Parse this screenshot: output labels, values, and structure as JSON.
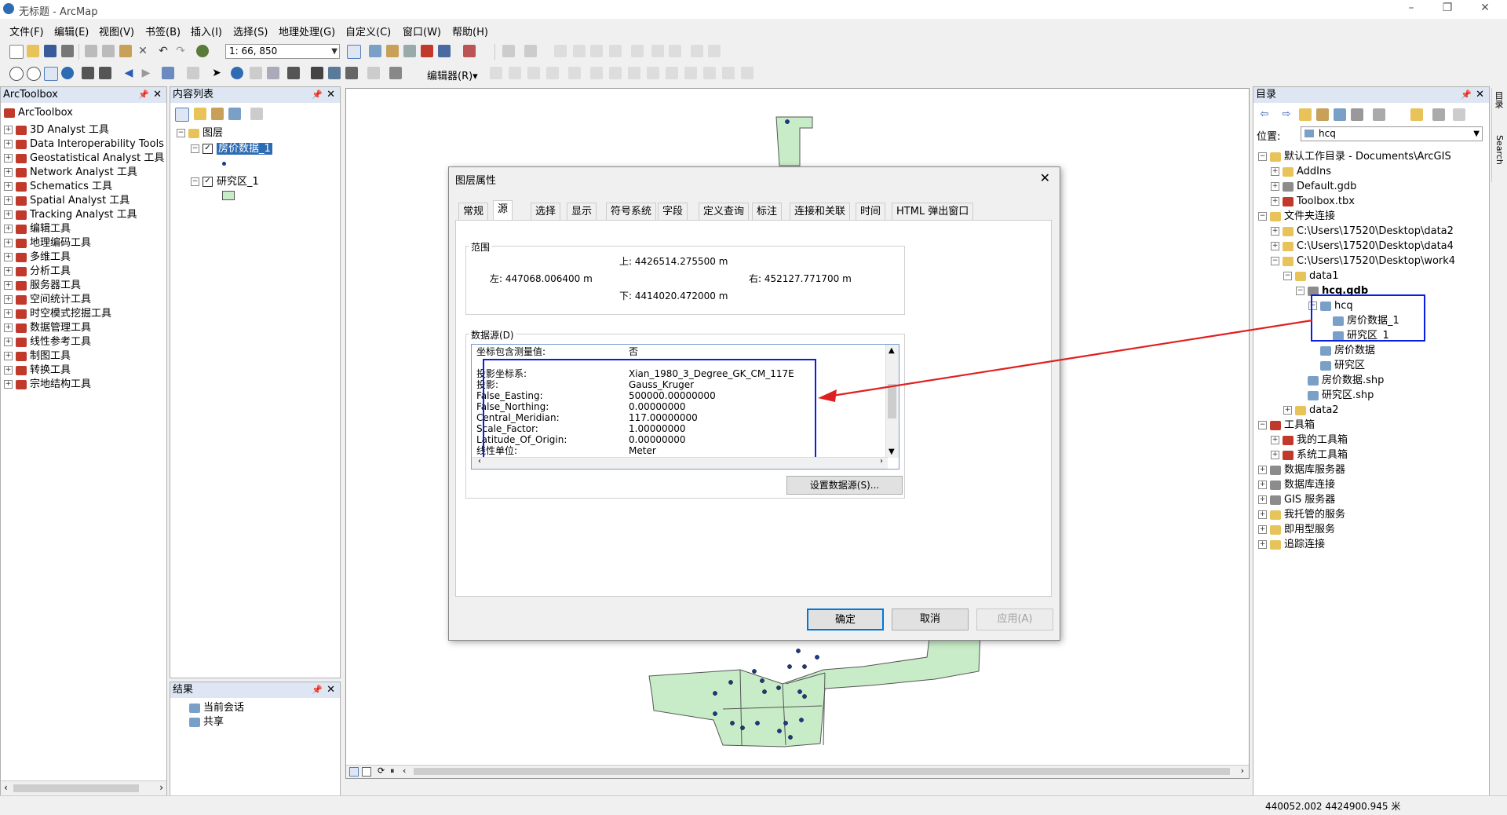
{
  "window": {
    "title": "无标题 - ArcMap"
  },
  "menu": [
    "文件(F)",
    "编辑(E)",
    "视图(V)",
    "书签(B)",
    "插入(I)",
    "选择(S)",
    "地理处理(G)",
    "自定义(C)",
    "窗口(W)",
    "帮助(H)"
  ],
  "toolbar": {
    "scale": "1: 66, 850",
    "editor": "编辑器(R)▾"
  },
  "arctoolbox": {
    "header": "ArcToolbox",
    "root": "ArcToolbox",
    "items": [
      "3D Analyst 工具",
      "Data Interoperability Tools",
      "Geostatistical Analyst 工具",
      "Network Analyst 工具",
      "Schematics 工具",
      "Spatial Analyst 工具",
      "Tracking Analyst 工具",
      "编辑工具",
      "地理编码工具",
      "多维工具",
      "分析工具",
      "服务器工具",
      "空间统计工具",
      "时空模式挖掘工具",
      "数据管理工具",
      "线性参考工具",
      "制图工具",
      "转换工具",
      "宗地结构工具"
    ]
  },
  "toc": {
    "header": "内容列表",
    "root": "图层",
    "layer1": "房价数据_1",
    "layer2": "研究区_1"
  },
  "results": {
    "header": "结果",
    "items": [
      "当前会话",
      "共享"
    ]
  },
  "catalog": {
    "header": "目录",
    "location_label": "位置:",
    "location_value": "hcq",
    "tree": [
      {
        "label": "默认工作目录 - Documents\\ArcGIS",
        "level": 0,
        "icon": "folder",
        "exp": "-"
      },
      {
        "label": "AddIns",
        "level": 1,
        "icon": "folder",
        "exp": "+"
      },
      {
        "label": "Default.gdb",
        "level": 1,
        "icon": "db",
        "exp": "+"
      },
      {
        "label": "Toolbox.tbx",
        "level": 1,
        "icon": "tbox",
        "exp": "+"
      },
      {
        "label": "文件夹连接",
        "level": 0,
        "icon": "folder",
        "exp": "-"
      },
      {
        "label": "C:\\Users\\17520\\Desktop\\data2",
        "level": 1,
        "icon": "folder",
        "exp": "+"
      },
      {
        "label": "C:\\Users\\17520\\Desktop\\data4",
        "level": 1,
        "icon": "folder",
        "exp": "+"
      },
      {
        "label": "C:\\Users\\17520\\Desktop\\work4",
        "level": 1,
        "icon": "folder",
        "exp": "-"
      },
      {
        "label": "data1",
        "level": 2,
        "icon": "folder",
        "exp": "-"
      },
      {
        "label": "hcq.gdb",
        "level": 3,
        "icon": "db",
        "exp": "-",
        "bold": true
      },
      {
        "label": "hcq",
        "level": 4,
        "icon": "layerico",
        "exp": "-"
      },
      {
        "label": "房价数据_1",
        "level": 5,
        "icon": "layerico",
        "exp": ""
      },
      {
        "label": "研究区_1",
        "level": 5,
        "icon": "layerico",
        "exp": ""
      },
      {
        "label": "房价数据",
        "level": 4,
        "icon": "layerico",
        "exp": ""
      },
      {
        "label": "研究区",
        "level": 4,
        "icon": "layerico",
        "exp": ""
      },
      {
        "label": "房价数据.shp",
        "level": 3,
        "icon": "layerico",
        "exp": ""
      },
      {
        "label": "研究区.shp",
        "level": 3,
        "icon": "layerico",
        "exp": ""
      },
      {
        "label": "data2",
        "level": 2,
        "icon": "folder",
        "exp": "+"
      },
      {
        "label": "工具箱",
        "level": 0,
        "icon": "tbox",
        "exp": "-"
      },
      {
        "label": "我的工具箱",
        "level": 1,
        "icon": "tbox",
        "exp": "+"
      },
      {
        "label": "系统工具箱",
        "level": 1,
        "icon": "tbox",
        "exp": "+"
      },
      {
        "label": "数据库服务器",
        "level": 0,
        "icon": "db",
        "exp": "+"
      },
      {
        "label": "数据库连接",
        "level": 0,
        "icon": "db",
        "exp": "+"
      },
      {
        "label": "GIS 服务器",
        "level": 0,
        "icon": "db",
        "exp": "+"
      },
      {
        "label": "我托管的服务",
        "level": 0,
        "icon": "folder",
        "exp": "+"
      },
      {
        "label": "即用型服务",
        "level": 0,
        "icon": "folder",
        "exp": "+"
      },
      {
        "label": "追踪连接",
        "level": 0,
        "icon": "folder",
        "exp": "+"
      }
    ]
  },
  "side_tabs": [
    "目录",
    "Search"
  ],
  "dialog": {
    "title": "图层属性",
    "tabs": [
      "常规",
      "源",
      "选择",
      "显示",
      "符号系统",
      "字段",
      "定义查询",
      "标注",
      "连接和关联",
      "时间",
      "HTML 弹出窗口"
    ],
    "extent_label": "范围",
    "top": "上:  4426514.275500 m",
    "left": "左:  447068.006400 m",
    "right": "右:  452127.771700 m",
    "bottom": "下:  4414020.472000 m",
    "source_label": "数据源(D)",
    "source": [
      [
        "坐标包含测量值:",
        "否"
      ],
      [
        "",
        ""
      ],
      [
        "投影坐标系:",
        "Xian_1980_3_Degree_GK_CM_117E"
      ],
      [
        "投影:",
        "Gauss_Kruger"
      ],
      [
        "False_Easting:",
        "500000.00000000"
      ],
      [
        "False_Northing:",
        "0.00000000"
      ],
      [
        "Central_Meridian:",
        "117.00000000"
      ],
      [
        "Scale_Factor:",
        "1.00000000"
      ],
      [
        "Latitude_Of_Origin:",
        "0.00000000"
      ],
      [
        "线性单位:",
        "Meter"
      ]
    ],
    "set_source_btn": "设置数据源(S)...",
    "ok": "确定",
    "cancel": "取消",
    "apply": "应用(A)"
  },
  "status": {
    "coords": "440052.002  4424900.945 米"
  },
  "colors": {
    "polygon_fill": "#c8ecc8",
    "point": "#1a3a8a",
    "highlight": "#0a1ee0",
    "arrow": "#e02020"
  }
}
